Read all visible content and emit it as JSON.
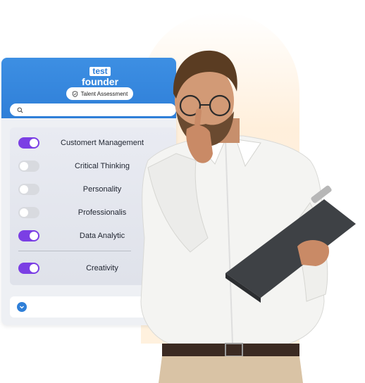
{
  "brand": {
    "logo_top": "test",
    "logo_bottom": "founder"
  },
  "badge": {
    "label": "Talent Assessment",
    "icon": "shield-check-icon"
  },
  "search": {
    "placeholder": "",
    "icon": "search-icon"
  },
  "skills": [
    {
      "label": "Customert Management",
      "enabled": true
    },
    {
      "label": "Critical Thinking",
      "enabled": false
    },
    {
      "label": "Personality",
      "enabled": false
    },
    {
      "label": "Professionalis",
      "enabled": false
    },
    {
      "label": "Data Analytic",
      "enabled": true
    },
    {
      "label": "Creativity",
      "enabled": true
    }
  ],
  "colors": {
    "header": "#2f7fd8",
    "toggle_on": "#7b3fe4",
    "toggle_off": "#d8dadf",
    "glow": "#ffe2be"
  }
}
